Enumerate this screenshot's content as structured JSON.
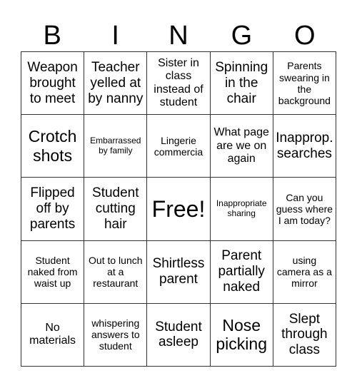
{
  "header": [
    "B",
    "I",
    "N",
    "G",
    "O"
  ],
  "cells": [
    {
      "text": "Weapon brought to meet",
      "size": "s-lg"
    },
    {
      "text": "Teacher yelled at by nanny",
      "size": "s-lg"
    },
    {
      "text": "Sister in class instead of student",
      "size": "s-md"
    },
    {
      "text": "Spinning in the chair",
      "size": "s-lg"
    },
    {
      "text": "Parents swearing in the background",
      "size": "s-sm"
    },
    {
      "text": "Crotch shots",
      "size": "s-xl"
    },
    {
      "text": "Embarrassed by family",
      "size": "s-xs"
    },
    {
      "text": "Lingerie commercia",
      "size": "s-sm"
    },
    {
      "text": "What page are we on again",
      "size": "s-md"
    },
    {
      "text": "Inapprop. searches",
      "size": "s-lg"
    },
    {
      "text": "Flipped off by parents",
      "size": "s-lg"
    },
    {
      "text": "Student cutting hair",
      "size": "s-lg"
    },
    {
      "text": "Free!",
      "size": "s-free"
    },
    {
      "text": "Inappropriate sharing",
      "size": "s-xs"
    },
    {
      "text": "Can you guess where I am today?",
      "size": "s-sm"
    },
    {
      "text": "Student naked from waist up",
      "size": "s-sm"
    },
    {
      "text": "Out to lunch at a restaurant",
      "size": "s-sm"
    },
    {
      "text": "Shirtless parent",
      "size": "s-lg"
    },
    {
      "text": "Parent partially naked",
      "size": "s-lg"
    },
    {
      "text": "using camera as a mirror",
      "size": "s-sm"
    },
    {
      "text": "No materials",
      "size": "s-md"
    },
    {
      "text": "whispering answers to student",
      "size": "s-sm"
    },
    {
      "text": "Student asleep",
      "size": "s-lg"
    },
    {
      "text": "Nose picking",
      "size": "s-xl"
    },
    {
      "text": "Slept through class",
      "size": "s-lg"
    }
  ]
}
